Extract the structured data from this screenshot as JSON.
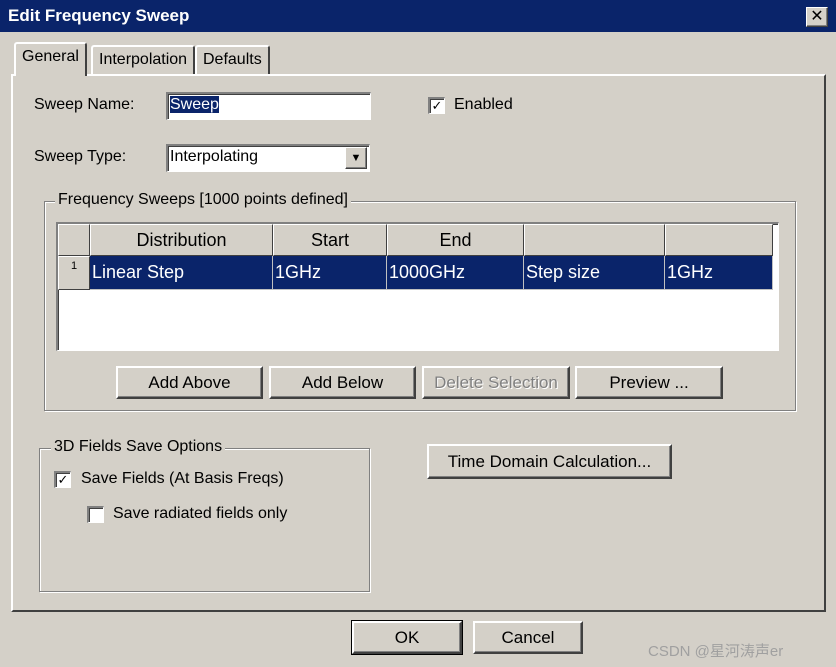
{
  "window": {
    "title": "Edit Frequency Sweep",
    "close_glyph": "✕"
  },
  "tabs": [
    {
      "label": "General",
      "active": true
    },
    {
      "label": "Interpolation",
      "active": false
    },
    {
      "label": "Defaults",
      "active": false
    }
  ],
  "general": {
    "sweep_name_label": "Sweep Name:",
    "sweep_name_value": "Sweep",
    "enabled_label": "Enabled",
    "enabled_checked": true,
    "sweep_type_label": "Sweep Type:",
    "sweep_type_value": "Interpolating"
  },
  "frequency_sweeps": {
    "title": "Frequency Sweeps [1000 points defined]",
    "columns": [
      "Distribution",
      "Start",
      "End",
      "",
      ""
    ],
    "rows": [
      {
        "index": "1",
        "cells": [
          "Linear Step",
          "1GHz",
          "1000GHz",
          "Step size",
          "1GHz"
        ]
      }
    ],
    "buttons": {
      "add_above": "Add Above",
      "add_below": "Add Below",
      "delete_selection": "Delete Selection",
      "preview": "Preview ..."
    }
  },
  "fields_save": {
    "title": "3D Fields Save Options",
    "save_fields_label": "Save Fields (At Basis Freqs)",
    "save_fields_checked": true,
    "save_radiated_label": "Save radiated fields only",
    "save_radiated_checked": false
  },
  "time_domain_button": "Time Domain Calculation...",
  "footer": {
    "ok": "OK",
    "cancel": "Cancel"
  },
  "watermark": "CSDN @星河涛声er",
  "colors": {
    "title_bar": "#0a246a",
    "face": "#d4d0c8",
    "selection": "#0a246a"
  }
}
